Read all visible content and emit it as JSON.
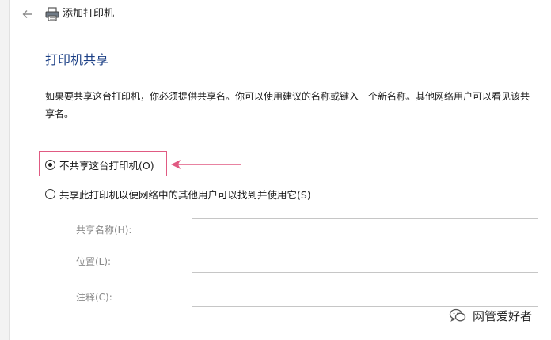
{
  "window": {
    "title": "添加打印机",
    "back_icon": "back-arrow-icon",
    "printer_icon": "printer-icon"
  },
  "page": {
    "heading": "打印机共享",
    "description": "如果要共享这台打印机，你必须提供共享名。你可以使用建议的名称或键入一个新名称。其他网络用户可以看见该共享名。"
  },
  "sharing_options": {
    "selected": "do_not_share",
    "do_not_share_label": "不共享这台打印机(O)",
    "share_label": "共享此打印机以便网络中的其他用户可以找到并使用它(S)"
  },
  "fields": {
    "share_name": {
      "label": "共享名称(H):",
      "value": ""
    },
    "location": {
      "label": "位置(L):",
      "value": ""
    },
    "comment": {
      "label": "注释(C):",
      "value": ""
    }
  },
  "annotation": {
    "highlight_color": "#e05a82"
  },
  "watermark": {
    "text": "网管爱好者",
    "icon": "wechat-icon"
  }
}
